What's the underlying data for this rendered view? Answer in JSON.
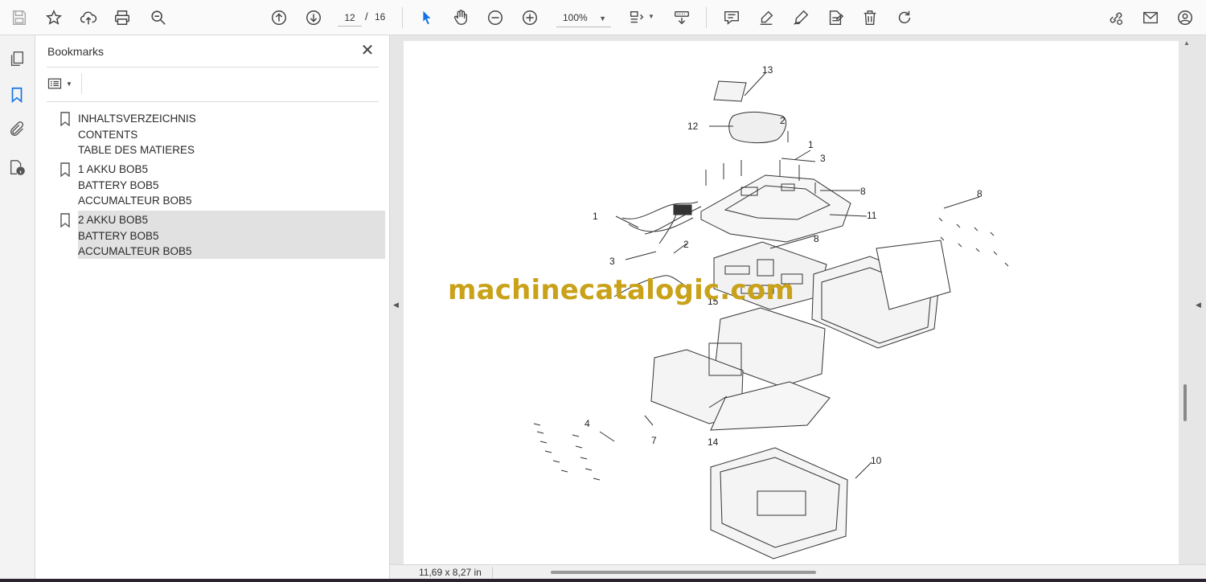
{
  "toolbar": {
    "left_tools": [
      "save-icon",
      "star-icon",
      "cloud-upload-icon",
      "print-icon",
      "zoom-search-icon"
    ],
    "page_current": "12",
    "page_separator": "/",
    "page_total": "16",
    "zoom": "100%",
    "accent": "#1473e6"
  },
  "rail": {
    "items": [
      "pages-icon",
      "bookmark-icon",
      "attachment-icon",
      "document-properties-icon"
    ]
  },
  "bookmarks": {
    "title": "Bookmarks",
    "close": "✕",
    "items": [
      {
        "lines": [
          "INHALTSVERZEICHNIS",
          "CONTENTS",
          "TABLE DES MATIERES"
        ]
      },
      {
        "lines": [
          "1 AKKU BOB5",
          "BATTERY BOB5",
          "ACCUMALTEUR BOB5"
        ]
      },
      {
        "lines": [
          "2 AKKU BOB5",
          "BATTERY BOB5",
          "ACCUMALTEUR BOB5"
        ],
        "selected": true
      }
    ]
  },
  "document": {
    "watermark": "machinecatalogic.com",
    "callouts": [
      "13",
      "12",
      "2",
      "1",
      "3",
      "8",
      "11",
      "1",
      "8",
      "3",
      "2",
      "8",
      "15",
      "4",
      "7",
      "14",
      "10"
    ]
  },
  "status": {
    "page_size": "11,69 x 8,27 in"
  }
}
